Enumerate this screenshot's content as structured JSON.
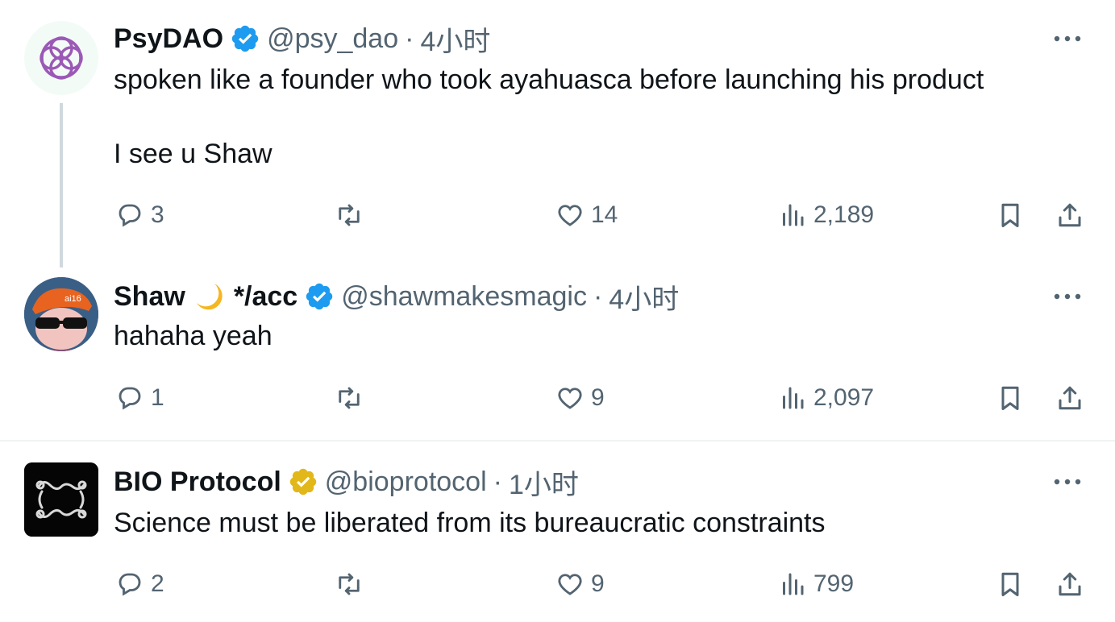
{
  "tweets": [
    {
      "name": "PsyDAO",
      "handle": "@psy_dao",
      "separator": "·",
      "time": "4小时",
      "text": "spoken like a founder who took ayahuasca before launching his product\n\nI see u Shaw",
      "replies": "3",
      "retweets": "",
      "likes": "14",
      "views": "2,189",
      "verified": "blue"
    },
    {
      "name": "Shaw",
      "name_suffix": "*/acc",
      "handle": "@shawmakesmagic",
      "separator": "·",
      "time": "4小时",
      "text": "hahaha yeah",
      "replies": "1",
      "retweets": "",
      "likes": "9",
      "views": "2,097",
      "verified": "blue"
    },
    {
      "name": "BIO Protocol",
      "handle": "@bioprotocol",
      "separator": "·",
      "time": "1小时",
      "text": "Science must be liberated from its bureaucratic constraints",
      "replies": "2",
      "retweets": "",
      "likes": "9",
      "views": "799",
      "verified": "gold"
    }
  ],
  "colors": {
    "text": "#0f1419",
    "secondary": "#536471",
    "verified_blue": "#1d9bf0",
    "verified_gold": "#e2b719",
    "psydao_purple": "#9b59b6"
  },
  "icons": [
    "reply-icon",
    "retweet-icon",
    "like-icon",
    "views-icon",
    "bookmark-icon",
    "share-icon",
    "more-icon",
    "verified-badge-icon",
    "moon-emoji-icon"
  ]
}
